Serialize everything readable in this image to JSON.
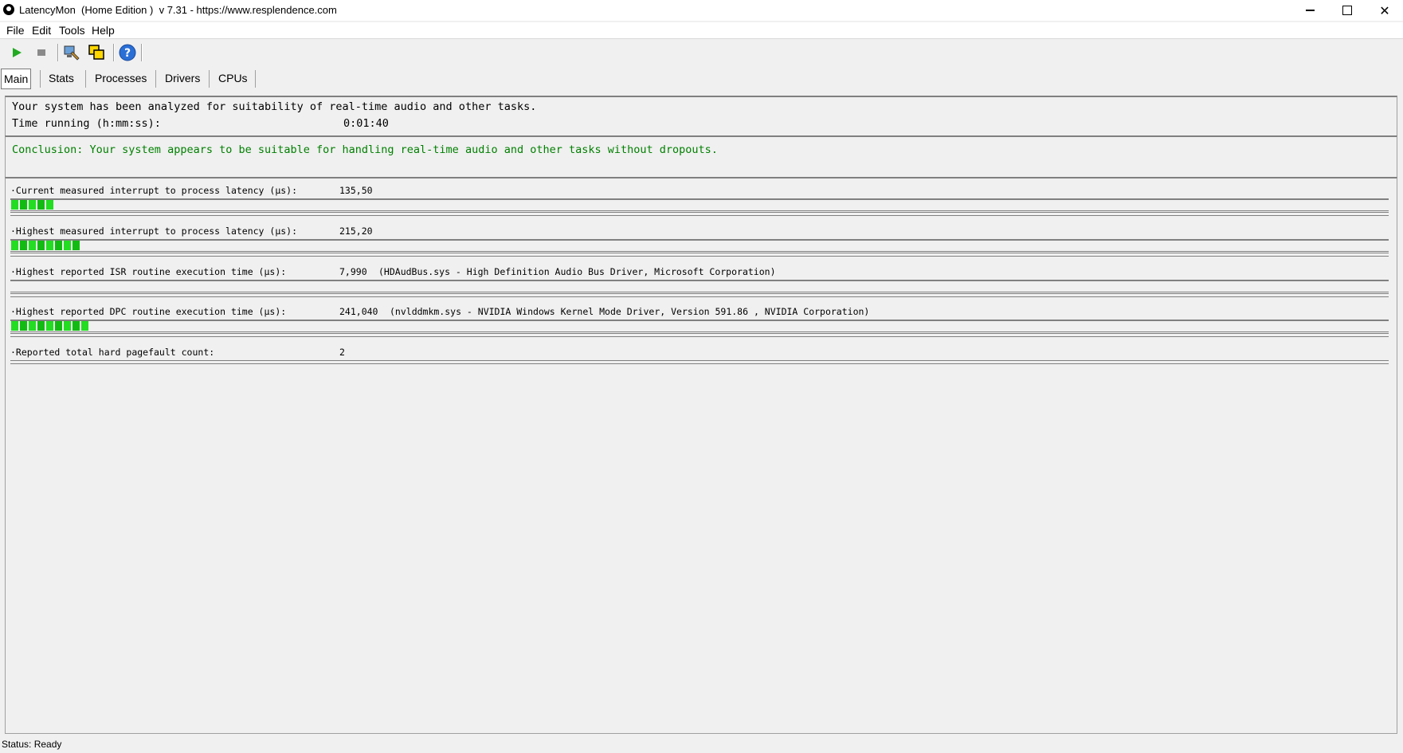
{
  "window": {
    "title": "LatencyMon  (Home Edition )  v 7.31 - https://www.resplendence.com",
    "controls": {
      "minimize": "minimize",
      "maximize": "maximize",
      "close": "✕"
    }
  },
  "menu": [
    "File",
    "Edit",
    "Tools",
    "Help"
  ],
  "toolbar": {
    "icons": [
      "play-icon",
      "stop-icon",
      "monitor-settings-icon",
      "windows-icon",
      "help-icon"
    ]
  },
  "tabs": [
    "Main",
    "Stats",
    "Processes",
    "Drivers",
    "CPUs"
  ],
  "info": {
    "line1": "Your system has been analyzed for suitability of real-time audio and other tasks.",
    "time_label": "Time running (h:mm:ss):",
    "time_value": "0:01:40"
  },
  "conclusion": {
    "text": "Conclusion: Your system appears to be suitable for handling real-time audio and other tasks without dropouts.",
    "color": "#008000"
  },
  "measurements": [
    {
      "label": "·Current measured interrupt to process latency (µs):",
      "value": "135,50",
      "detail": "",
      "segments": 5
    },
    {
      "label": "·Highest measured interrupt to process latency (µs):",
      "value": "215,20",
      "detail": "",
      "segments": 8
    },
    {
      "label": "·Highest reported ISR routine execution time (µs):",
      "value": "7,990",
      "detail": "(HDAudBus.sys - High Definition Audio Bus Driver, Microsoft Corporation)",
      "segments": 0
    },
    {
      "label": "·Highest reported DPC routine execution time (µs):",
      "value": "241,040",
      "detail": "(nvlddmkm.sys - NVIDIA Windows Kernel Mode Driver, Version 591.86 , NVIDIA Corporation)",
      "segments": 9
    },
    {
      "label": "·Reported total hard pagefault count:",
      "value": "2",
      "detail": "",
      "segments": null
    }
  ],
  "status": "Status: Ready",
  "colors": {
    "bar_green": "#22dd22",
    "conclusion": "#008000"
  }
}
